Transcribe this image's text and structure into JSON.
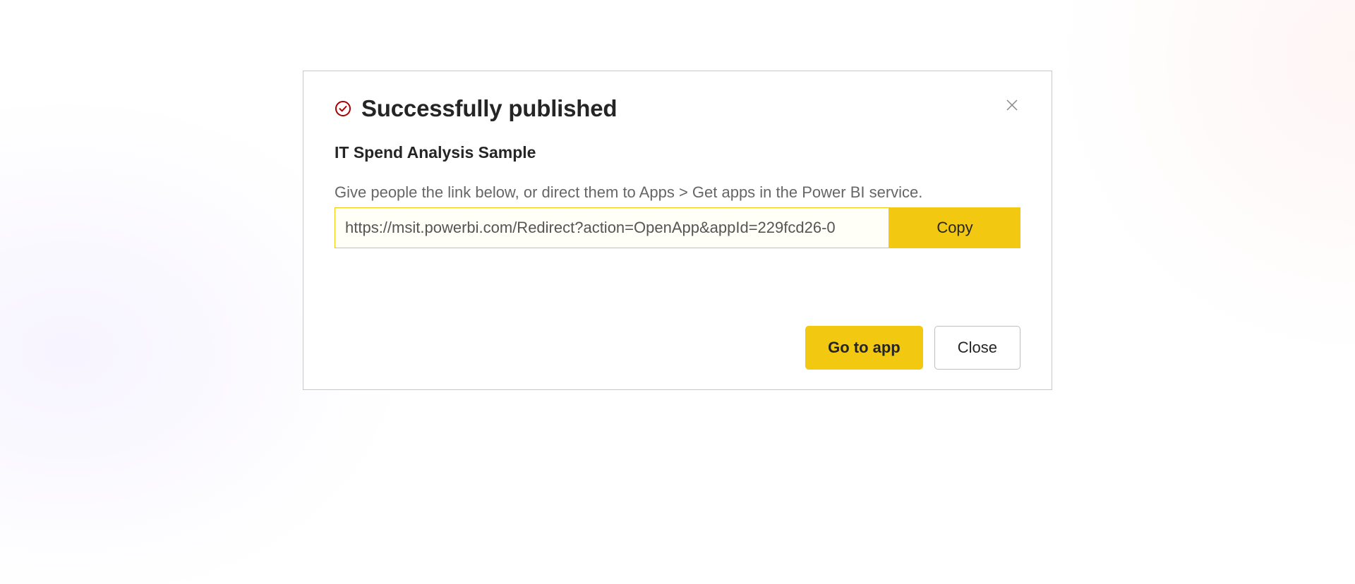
{
  "dialog": {
    "title": "Successfully published",
    "app_name": "IT Spend Analysis Sample",
    "instructions": "Give people the link below, or direct them to Apps > Get apps in the Power BI service.",
    "link_value": "https://msit.powerbi.com/Redirect?action=OpenApp&appId=229fcd26-0",
    "copy_label": "Copy",
    "go_to_app_label": "Go to app",
    "close_label": "Close"
  },
  "colors": {
    "accent": "#f2c811",
    "text_primary": "#252525",
    "text_secondary": "#666666",
    "icon_success": "#a80000"
  }
}
